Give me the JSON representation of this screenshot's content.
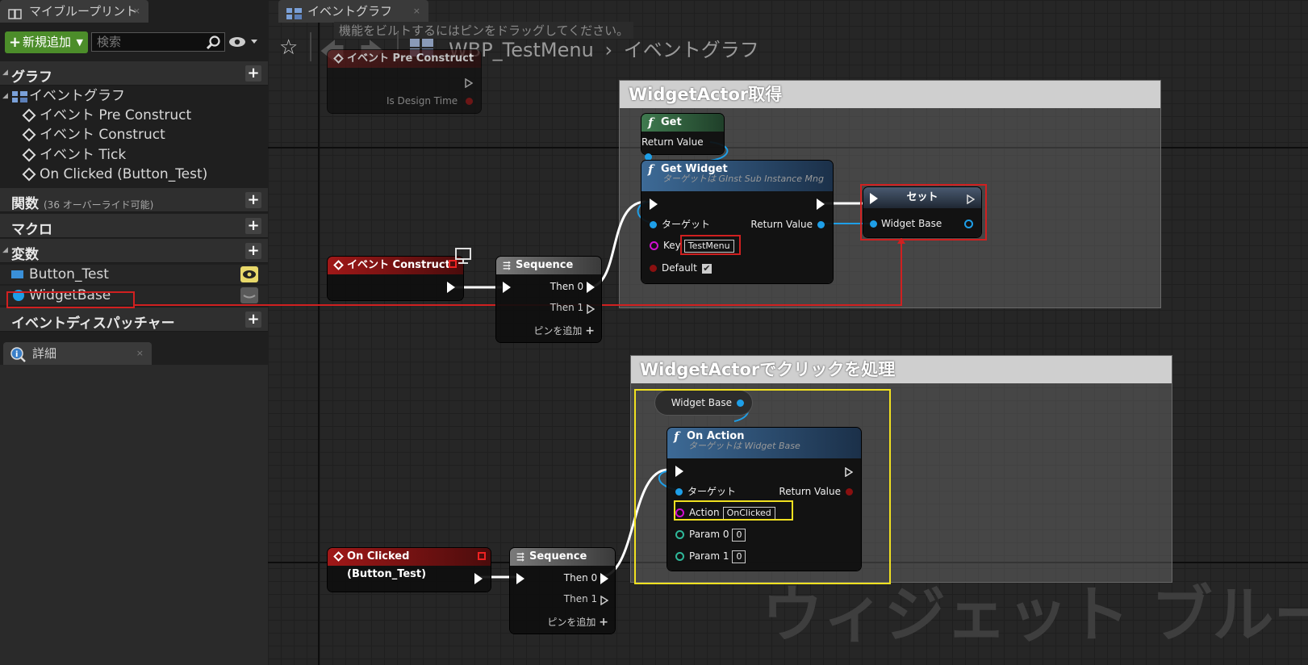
{
  "left_panel": {
    "tab_title": "マイブループリント",
    "tab_close": "×",
    "add_new_label": "新規追加",
    "search_placeholder": "検索",
    "sections": {
      "graphs": "グラフ",
      "functions": "関数",
      "functions_sub": "(36 オーバーライド可能)",
      "macros": "マクロ",
      "variables": "変数",
      "dispatchers": "イベントディスパッチャー"
    },
    "graph_items": {
      "event_graph": "イベントグラフ",
      "pre_construct": "イベント Pre Construct",
      "construct": "イベント Construct",
      "tick": "イベント Tick",
      "on_clicked": "On Clicked (Button_Test)"
    },
    "variables": [
      {
        "name": "Button_Test",
        "color": "#3a8fd8"
      },
      {
        "name": "WidgetBase",
        "color": "#1e9fe8"
      }
    ],
    "details_tab": "詳細"
  },
  "graph": {
    "tab_title": "イベントグラフ",
    "tab_close": "×",
    "compile_hint": "機能をビルトするにはピンをドラッグしてください。",
    "breadcrumb_root": "WBP_TestMenu",
    "breadcrumb_sep": "›",
    "breadcrumb_current": "イベントグラフ",
    "watermark": "ウィジェット ブルー",
    "comments": {
      "c1": "WidgetActor取得",
      "c2": "WidgetActorでクリックを処理"
    },
    "nodes": {
      "pre_construct": {
        "title": "イベント Pre Construct",
        "pin": "Is Design Time"
      },
      "construct": {
        "title": "イベント Construct"
      },
      "sequence1": {
        "title": "Sequence",
        "then0": "Then 0",
        "then1": "Then 1",
        "add_pin": "ピンを追加"
      },
      "get": {
        "title": "Get",
        "ret": "Return Value"
      },
      "get_widget": {
        "title": "Get Widget",
        "sub": "ターゲットは GInst Sub Instance Mng",
        "target": "ターゲット",
        "key": "Key",
        "key_value": "TestMenu",
        "default": "Default",
        "ret": "Return Value"
      },
      "set": {
        "title": "セット",
        "pin": "Widget Base"
      },
      "on_clicked": {
        "title": "On Clicked (Button_Test)"
      },
      "sequence2": {
        "title": "Sequence",
        "then0": "Then 0",
        "then1": "Then 1",
        "add_pin": "ピンを追加"
      },
      "widget_base_get": {
        "pin": "Widget Base"
      },
      "on_action": {
        "title": "On Action",
        "sub": "ターゲットは Widget Base",
        "target": "ターゲット",
        "ret": "Return Value",
        "action": "Action",
        "action_value": "OnClicked",
        "param0": "Param 0",
        "param0_value": "0",
        "param1": "Param 1",
        "param1_value": "0"
      }
    }
  }
}
